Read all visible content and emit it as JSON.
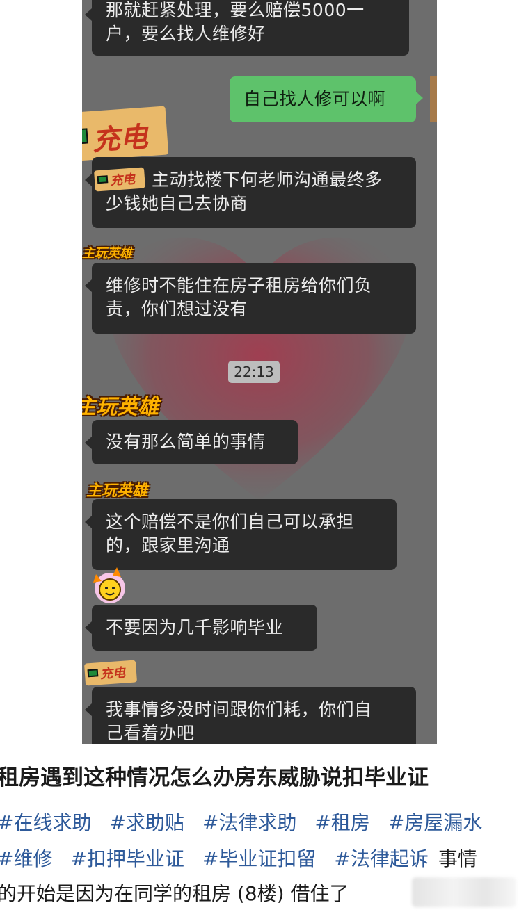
{
  "chat": {
    "messages": [
      "那就赶紧处理，要么赔偿5000一户，要么找人维修好",
      "自己找人修可以啊",
      "主动找楼下何老师沟通最终多少钱她自己去协商",
      "维修时不能住在房子租房给你们负责，你们想过没有",
      "没有那么简单的事情",
      "这个赔偿不是你们自己可以承担的，跟家里沟通",
      "不要因为几千影响毕业",
      "我事情多没时间跟你们耗，你们自己看着办吧"
    ],
    "msg_lines": [
      [
        "那就赶紧处理，要么赔偿5000一",
        "户，要么找人维修好"
      ],
      [
        "自己找人修可以啊"
      ],
      [
        "主动找楼下何老师沟通最终多",
        "少钱她自己去协商"
      ],
      [
        "维修时不能住在房子租房给你们负",
        "责，你们想过没有"
      ],
      [
        "没有那么简单的事情"
      ],
      [
        "这个赔偿不是你们自己可以承担",
        "的，跟家里沟通"
      ],
      [
        "不要因为几千影响毕业"
      ],
      [
        "我事情多没时间跟你们耗，你们自",
        "己看着办吧"
      ]
    ],
    "timestamp": "22:13",
    "sticker_charge": "充电",
    "sticker_hero": "主玩英雄"
  },
  "post": {
    "title": "租房遇到这种情况怎么办房东威胁说扣毕业证",
    "hashtags_line1": [
      "#在线求助",
      "#求助贴",
      "#法律求助",
      "#租房",
      "#房屋漏水"
    ],
    "hashtags_line2": [
      "#维修",
      "#扣押毕业证",
      "#毕业证扣留",
      "#法律起诉"
    ],
    "line2_tail": "事情",
    "line3": "的开始是因为在同学的租房 (8楼) 借住了"
  },
  "colors": {
    "chat_bg": "#6d6d6d",
    "bubble_in": "#2a2a2a",
    "bubble_out": "#5ec26b",
    "hashtag": "#2e5a9a"
  }
}
